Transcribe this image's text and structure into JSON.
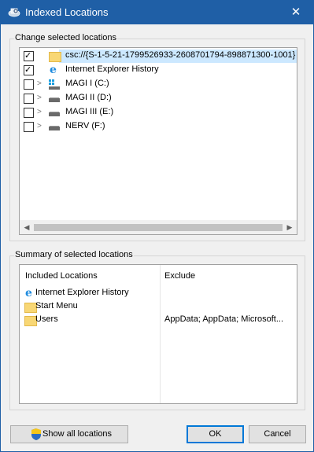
{
  "window": {
    "title": "Indexed Locations",
    "close_glyph": "✕"
  },
  "change_group": {
    "label": "Change selected locations",
    "items": [
      {
        "label": "csc://{S-1-5-21-1799526933-2608701794-898871300-1001}",
        "checked": true,
        "icon": "folder-icon",
        "expandable": false,
        "selected": true
      },
      {
        "label": "Internet Explorer History",
        "checked": true,
        "icon": "internet-explorer-icon",
        "expandable": false,
        "selected": false
      },
      {
        "label": "MAGI I (C:)",
        "checked": false,
        "icon": "windows-drive-icon",
        "expandable": true,
        "selected": false
      },
      {
        "label": "MAGI II (D:)",
        "checked": false,
        "icon": "drive-icon",
        "expandable": true,
        "selected": false
      },
      {
        "label": "MAGI III (E:)",
        "checked": false,
        "icon": "drive-icon",
        "expandable": true,
        "selected": false
      },
      {
        "label": "NERV (F:)",
        "checked": false,
        "icon": "drive-icon",
        "expandable": true,
        "selected": false
      }
    ],
    "check_glyph": "✓",
    "expander_glyph": ">",
    "scroll_left_glyph": "◀",
    "scroll_right_glyph": "▶"
  },
  "summary_group": {
    "label": "Summary of selected locations",
    "included_header": "Included Locations",
    "exclude_header": "Exclude",
    "rows": [
      {
        "location": "Internet Explorer History",
        "icon": "internet-explorer-icon",
        "exclude": ""
      },
      {
        "location": "Start Menu",
        "icon": "folder-icon",
        "exclude": ""
      },
      {
        "location": "Users",
        "icon": "folder-icon",
        "exclude": "AppData; AppData; Microsoft..."
      }
    ]
  },
  "buttons": {
    "show_all": "Show all locations",
    "ok": "OK",
    "cancel": "Cancel"
  },
  "colors": {
    "titlebar": "#1f5fa6",
    "selection": "#cce8ff",
    "folder": "#f8d775"
  }
}
